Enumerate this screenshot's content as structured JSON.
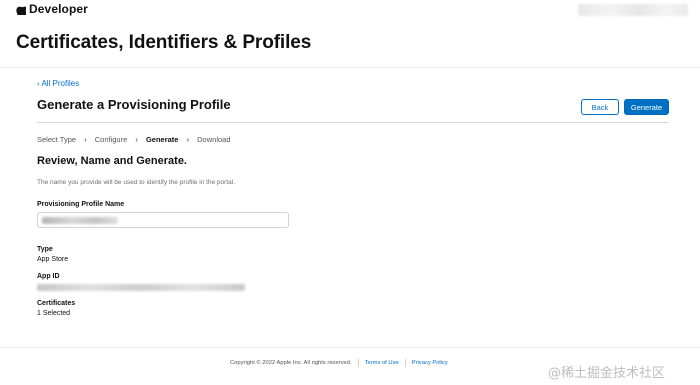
{
  "header": {
    "brand_label": "Developer"
  },
  "page": {
    "title": "Certificates, Identifiers & Profiles"
  },
  "content": {
    "back_link": "‹ All Profiles",
    "section_title": "Generate a Provisioning Profile",
    "back_button": "Back",
    "generate_button": "Generate",
    "steps": [
      {
        "label": "Select Type",
        "active": false
      },
      {
        "label": "Configure",
        "active": false
      },
      {
        "label": "Generate",
        "active": true
      },
      {
        "label": "Download",
        "active": false
      }
    ],
    "review_title": "Review, Name and Generate.",
    "hint": "The name you provide will be used to identify the profile in the portal.",
    "profile_name_label": "Provisioning Profile Name",
    "type_label": "Type",
    "type_value": "App Store",
    "app_id_label": "App ID",
    "certificates_label": "Certificates",
    "certificates_value": "1 Selected"
  },
  "footer": {
    "copyright": "Copyright © 2022 Apple Inc. All rights reserved.",
    "terms": "Terms of Use",
    "privacy": "Privacy Policy"
  },
  "watermark": "@稀土掘金技术社区",
  "colors": {
    "accent": "#0070c9",
    "button_primary": "#0071c2"
  }
}
